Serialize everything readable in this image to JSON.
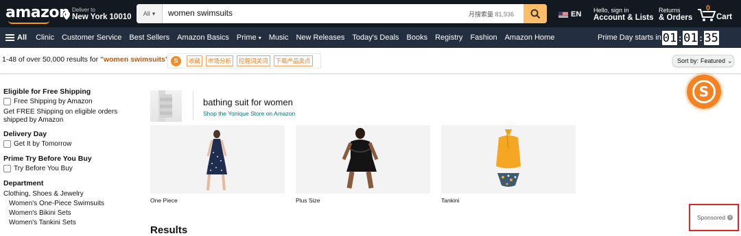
{
  "header": {
    "logo": "amazon",
    "deliver_line1": "Deliver to",
    "deliver_line2": "New York 10010",
    "search_category": "All",
    "search_query": "women swimsuits",
    "monthly_search_label": "月搜索量",
    "monthly_search_value": "81,936",
    "language": "EN",
    "account_line1": "Hello, sign in",
    "account_line2": "Account & Lists",
    "orders_line1": "Returns",
    "orders_line2": "& Orders",
    "cart_count": "0",
    "cart_label": "Cart"
  },
  "nav": {
    "all_label": "All",
    "items": [
      "Clinic",
      "Customer Service",
      "Best Sellers",
      "Amazon Basics",
      "Prime",
      "Music",
      "New Releases",
      "Today's Deals",
      "Books",
      "Registry",
      "Fashion",
      "Amazon Home"
    ],
    "prime_day_label": "Prime Day starts in",
    "timer": [
      "01",
      "01",
      "35"
    ]
  },
  "results_bar": {
    "count_text": "1-48 of over 50,000 results for ",
    "query": "\"women swimsuits\"",
    "plugin_tags": [
      "收藏",
      "市场分析",
      "挖掘词关词",
      "下载产品卖点"
    ],
    "sort_label": "Sort by:",
    "sort_value": "Featured"
  },
  "sidebar": {
    "free_shipping_title": "Eligible for Free Shipping",
    "free_shipping_option": "Free Shipping by Amazon",
    "free_shipping_note": "Get FREE Shipping on eligible orders shipped by Amazon",
    "delivery_title": "Delivery Day",
    "delivery_option": "Get It by Tomorrow",
    "prime_try_title": "Prime Try Before You Buy",
    "prime_try_option": "Try Before You Buy",
    "department_title": "Department",
    "department_root": "Clothing, Shoes & Jewelry",
    "department_items": [
      "Women's One-Piece Swimsuits",
      "Women's Bikini Sets",
      "Women's Tankini Sets"
    ]
  },
  "brand_ad": {
    "title": "bathing suit for women",
    "link": "Shop the Yonique Store on Amazon",
    "cards": [
      "One Piece",
      "Plus Size",
      "Tankini"
    ]
  },
  "main": {
    "results_heading": "Results",
    "sponsored_label": "Sponsored"
  },
  "colors": {
    "topbar": "#131921",
    "navbar": "#232f3e",
    "accent": "#febd69",
    "query_color": "#c45500",
    "link": "#007185",
    "highlight_box": "#e02424"
  }
}
